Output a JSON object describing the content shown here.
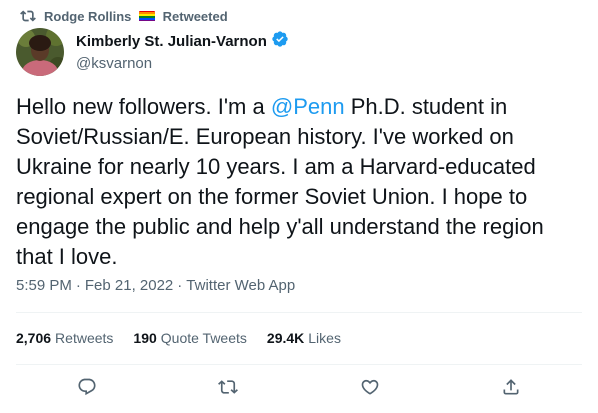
{
  "retweet_header": {
    "icon": "retweet-icon",
    "retweeter_name": "Rodge Rollins",
    "retweeter_flag": "rainbow-flag-icon",
    "label": "Retweeted"
  },
  "author": {
    "display_name": "Kimberly St. Julian-Varnon",
    "verified_icon": "verified-badge-icon",
    "handle": "@ksvarnon",
    "avatar": "avatar"
  },
  "tweet": {
    "text_before": "Hello new followers. I'm a ",
    "mention": "@Penn",
    "text_after": " Ph.D. student in Soviet/Russian/E. European history. I've worked on Ukraine for nearly 10 years. I am a Harvard-educated regional expert on the former Soviet Union. I hope to engage the public and help y'all understand the region that I love."
  },
  "meta": {
    "time": "5:59 PM",
    "separator": "·",
    "date": "Feb 21, 2022",
    "source": "Twitter Web App"
  },
  "stats": {
    "retweets_count": "2,706",
    "retweets_label": "Retweets",
    "quote_count": "190",
    "quote_label": "Quote Tweets",
    "likes_count": "29.4K",
    "likes_label": "Likes"
  },
  "actions": [
    {
      "name": "reply-button",
      "icon": "reply-icon"
    },
    {
      "name": "retweet-button",
      "icon": "retweet-icon"
    },
    {
      "name": "like-button",
      "icon": "heart-icon"
    },
    {
      "name": "share-button",
      "icon": "share-icon"
    }
  ],
  "colors": {
    "text_primary": "#0f1419",
    "text_secondary": "#536471",
    "link": "#1d9bf0",
    "divider": "#eff3f4",
    "verified": "#1d9bf0"
  }
}
